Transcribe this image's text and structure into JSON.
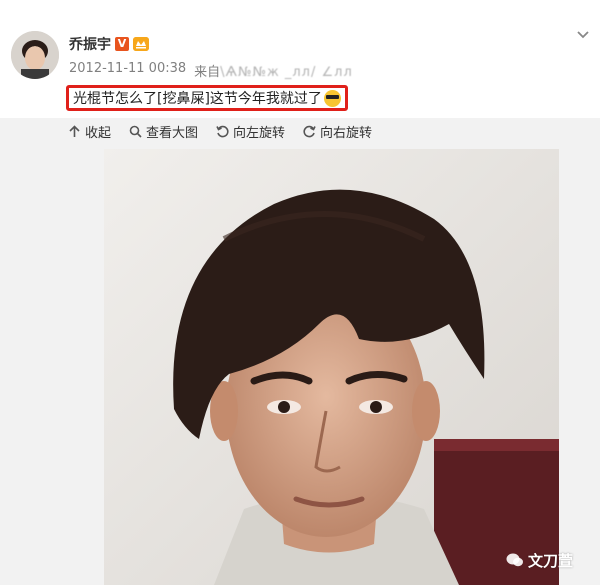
{
  "author": {
    "name": "乔振宇",
    "verified_badge": "V",
    "vip_badge_icon": "vip-badge-icon",
    "avatar_icon": "avatar-photo"
  },
  "post": {
    "timestamp": "2012-11-11 00:38",
    "source_prefix": "来自",
    "source_name": "\\Ѧ№№ж _лл/ ∠лл",
    "text": "光棍节怎么了[挖鼻屎]这节今年我就过了",
    "text_emoji_icon": "sunglasses-emoji-icon"
  },
  "toolbar": {
    "collapse": "收起",
    "view_large": "查看大图",
    "rotate_left": "向左旋转",
    "rotate_right": "向右旋转"
  },
  "watermark": {
    "text": "文刀萱"
  },
  "colors": {
    "highlight_border": "#e0201a",
    "verified": "#e8541e",
    "vip": "#f7a71b",
    "meta_text": "#808080"
  }
}
